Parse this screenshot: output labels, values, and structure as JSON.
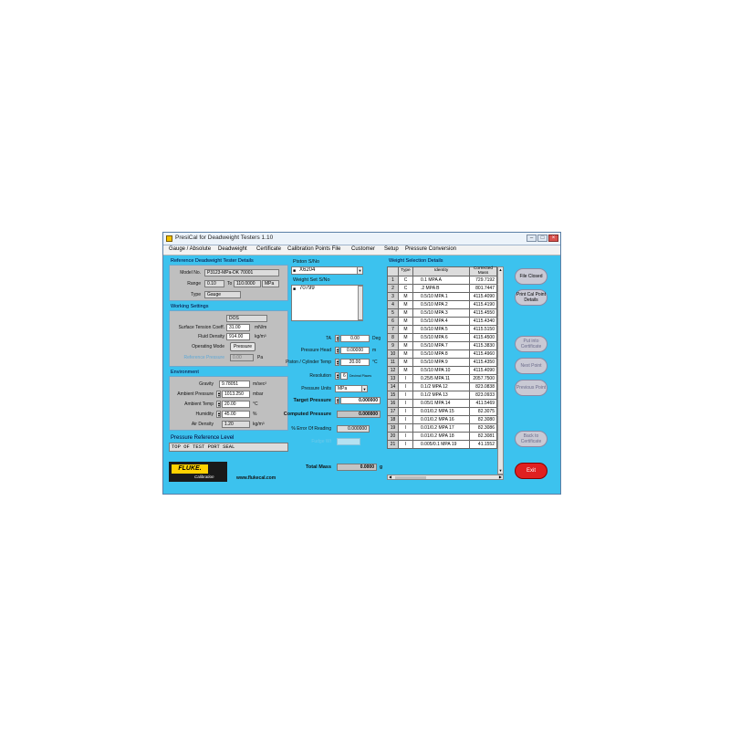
{
  "window": {
    "title": "PresiCal for Deadweight Testers 1.10",
    "minimize": "–",
    "maximize": "□",
    "close": "×"
  },
  "menu": [
    "Gauge / Absolute",
    "Deadweight",
    "Certificate",
    "Calibration Points File",
    "Customer",
    "Setup",
    "Pressure Conversion"
  ],
  "ref_details": {
    "title": "Reference Deadweight Tester Details",
    "model_label": "Model No.",
    "model_value": "P3123-MPa-DK 70001",
    "range_label": "Range",
    "range_from": "0.10",
    "range_to_label": "To",
    "range_to": "110.0000",
    "range_unit": "MPa",
    "type_label": "Type",
    "type_value": "Gauge"
  },
  "working": {
    "title": "Working Settings",
    "fluid": "DOS",
    "surface_label": "Surface Tension Coeff.",
    "surface_value": "31.00",
    "surface_unit": "mN/m",
    "density_label": "Fluid Density",
    "density_value": "914.00",
    "density_unit": "kg/m³",
    "mode_label": "Operating Mode",
    "mode_button": "Pressure",
    "ref_label": "Reference Pressure",
    "ref_value": "0.00",
    "ref_unit": "Pa"
  },
  "environment": {
    "title": "Environment",
    "gravity_label": "Gravity",
    "gravity_value": "9.78051",
    "gravity_unit": "m/sec²",
    "amb_p_label": "Ambient Pressure",
    "amb_p_value": "1013.250",
    "amb_p_unit": "mbar",
    "amb_t_label": "Ambient Temp",
    "amb_t_value": "20.00",
    "amb_t_unit": "°C",
    "hum_label": "Humidity",
    "hum_value": "45.00",
    "hum_unit": "%",
    "air_label": "Air Density",
    "air_value": "1.20",
    "air_unit": "kg/m³"
  },
  "ref_level": {
    "title": "Pressure Reference Level",
    "value": "TOP OF TEST PORT SEAL"
  },
  "brand": {
    "logo": "FLUKE.",
    "sub": "Calibration",
    "url": "www.flukecal.com"
  },
  "piston": {
    "label": "Piston S/No",
    "value": "X6204",
    "weight_label": "Weight Set S/No",
    "weight_value": "70799"
  },
  "params": {
    "ta_label": "TA",
    "ta_value": "0.00",
    "ta_unit": "Deg",
    "head_label": "Pressure Head",
    "head_value": "0.00000",
    "head_unit": "m",
    "temp_label": "Piston / Cylinder Temp",
    "temp_value": "20.00",
    "temp_unit": "°C",
    "res_label": "Resolution",
    "res_value": "6",
    "res_unit": "Decimal Places",
    "units_label": "Pressure Units",
    "units_value": "MPa",
    "target_label": "Target Pressure",
    "target_value": "0.000000",
    "computed_label": "Computed Pressure",
    "computed_value": "0.000000",
    "error_label": "% Error Of Reading",
    "error_value": "0.000000",
    "faded_label": "Fudge Wt",
    "mass_label": "Total Mass",
    "mass_value": "0.0000",
    "mass_unit": "g"
  },
  "weights": {
    "title": "Weight Selection Details",
    "headers": [
      "",
      "Type",
      "Identity",
      "Corrected Mass"
    ],
    "rows": [
      [
        "1",
        "C",
        "0.1 MPA A",
        "729.7192"
      ],
      [
        "2",
        "C",
        ".2 MPA B",
        "801.7447"
      ],
      [
        "3",
        "M",
        "0.5/10 MPA 1",
        "4115.4090"
      ],
      [
        "4",
        "M",
        "0.5/10 MPA 2",
        "4115.4190"
      ],
      [
        "5",
        "M",
        "0.5/10 MPA 3",
        "4115.4550"
      ],
      [
        "6",
        "M",
        "0.5/10 MPA 4",
        "4115.4340"
      ],
      [
        "7",
        "M",
        "0.5/10 MPA 5",
        "4115.5150"
      ],
      [
        "8",
        "M",
        "0.5/10 MPA 6",
        "4115.4500"
      ],
      [
        "9",
        "M",
        "0.5/10 MPA 7",
        "4115.3830"
      ],
      [
        "10",
        "M",
        "0.5/10 MPA 8",
        "4115.4960"
      ],
      [
        "11",
        "M",
        "0.5/10 MPA 9",
        "4115.4350"
      ],
      [
        "12",
        "M",
        "0.5/10 MPA 10",
        "4115.4090"
      ],
      [
        "13",
        "I",
        "0.25/5 MPA 11",
        "2057.7500"
      ],
      [
        "14",
        "I",
        "0.1/2 MPA 12",
        "823.0838"
      ],
      [
        "15",
        "I",
        "0.1/2 MPA 13",
        "823.0933"
      ],
      [
        "16",
        "I",
        "0.05/1 MPA 14",
        "411.5469"
      ],
      [
        "17",
        "I",
        "0.01/0.2 MPA 15",
        "82.3075"
      ],
      [
        "18",
        "I",
        "0.01/0.2 MPA 16",
        "82.3080"
      ],
      [
        "19",
        "I",
        "0.01/0.2 MPA 17",
        "82.3086"
      ],
      [
        "20",
        "I",
        "0.01/0.2 MPA 18",
        "82.3081"
      ],
      [
        "21",
        "I",
        "0.005/0.1 MPA 19",
        "41.1552"
      ]
    ]
  },
  "side_buttons": {
    "file": "File Closed",
    "point": "Print Cal Point Details",
    "put": "Put into Certificate",
    "next": "Next Point",
    "prev": "Previous Point",
    "back": "Back to Certificate",
    "exit": "Exit"
  }
}
